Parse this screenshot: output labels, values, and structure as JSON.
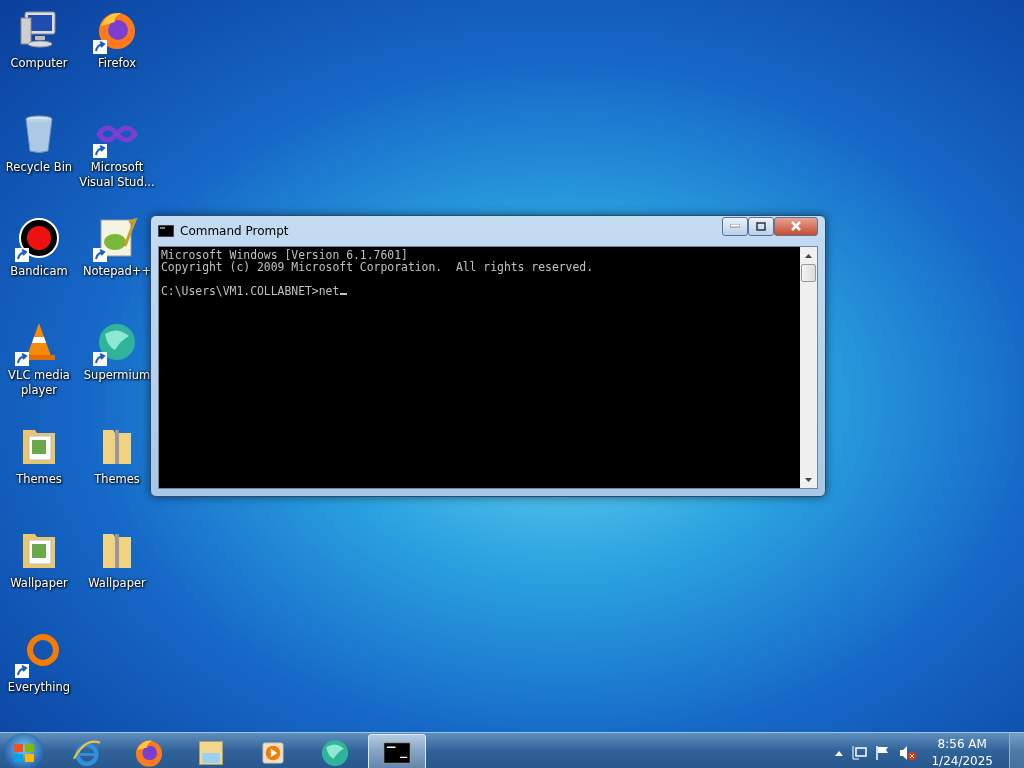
{
  "desktop_icons": [
    {
      "label": "Computer",
      "kind": "computer",
      "shortcut": false
    },
    {
      "label": "Firefox",
      "kind": "firefox",
      "shortcut": true
    },
    {
      "label": "Recycle Bin",
      "kind": "recycle",
      "shortcut": false
    },
    {
      "label": "Microsoft Visual Stud...",
      "kind": "vs",
      "shortcut": true
    },
    {
      "label": "Bandicam",
      "kind": "record",
      "shortcut": true
    },
    {
      "label": "Notepad++",
      "kind": "notepad",
      "shortcut": true
    },
    {
      "label": "VLC media player",
      "kind": "cone",
      "shortcut": true
    },
    {
      "label": "Supermium",
      "kind": "globe",
      "shortcut": true
    },
    {
      "label": "Themes",
      "kind": "folder",
      "shortcut": false
    },
    {
      "label": "Themes",
      "kind": "zip",
      "shortcut": false
    },
    {
      "label": "Wallpaper",
      "kind": "folder",
      "shortcut": false
    },
    {
      "label": "Wallpaper",
      "kind": "zip",
      "shortcut": false
    },
    {
      "label": "Everything",
      "kind": "ring",
      "shortcut": true
    }
  ],
  "window": {
    "title": "Command Prompt",
    "console_lines": [
      "Microsoft Windows [Version 6.1.7601]",
      "Copyright (c) 2009 Microsoft Corporation.  All rights reserved."
    ],
    "prompt": "C:\\Users\\VM1.COLLABNET>net"
  },
  "taskbar": {
    "items": [
      {
        "kind": "ie",
        "selected": false
      },
      {
        "kind": "firefox",
        "selected": false
      },
      {
        "kind": "explorer",
        "selected": false
      },
      {
        "kind": "media",
        "selected": false
      },
      {
        "kind": "globe",
        "selected": false
      },
      {
        "kind": "cmd",
        "selected": true
      }
    ],
    "clock": {
      "time": "8:56 AM",
      "date": "1/24/2025"
    }
  }
}
